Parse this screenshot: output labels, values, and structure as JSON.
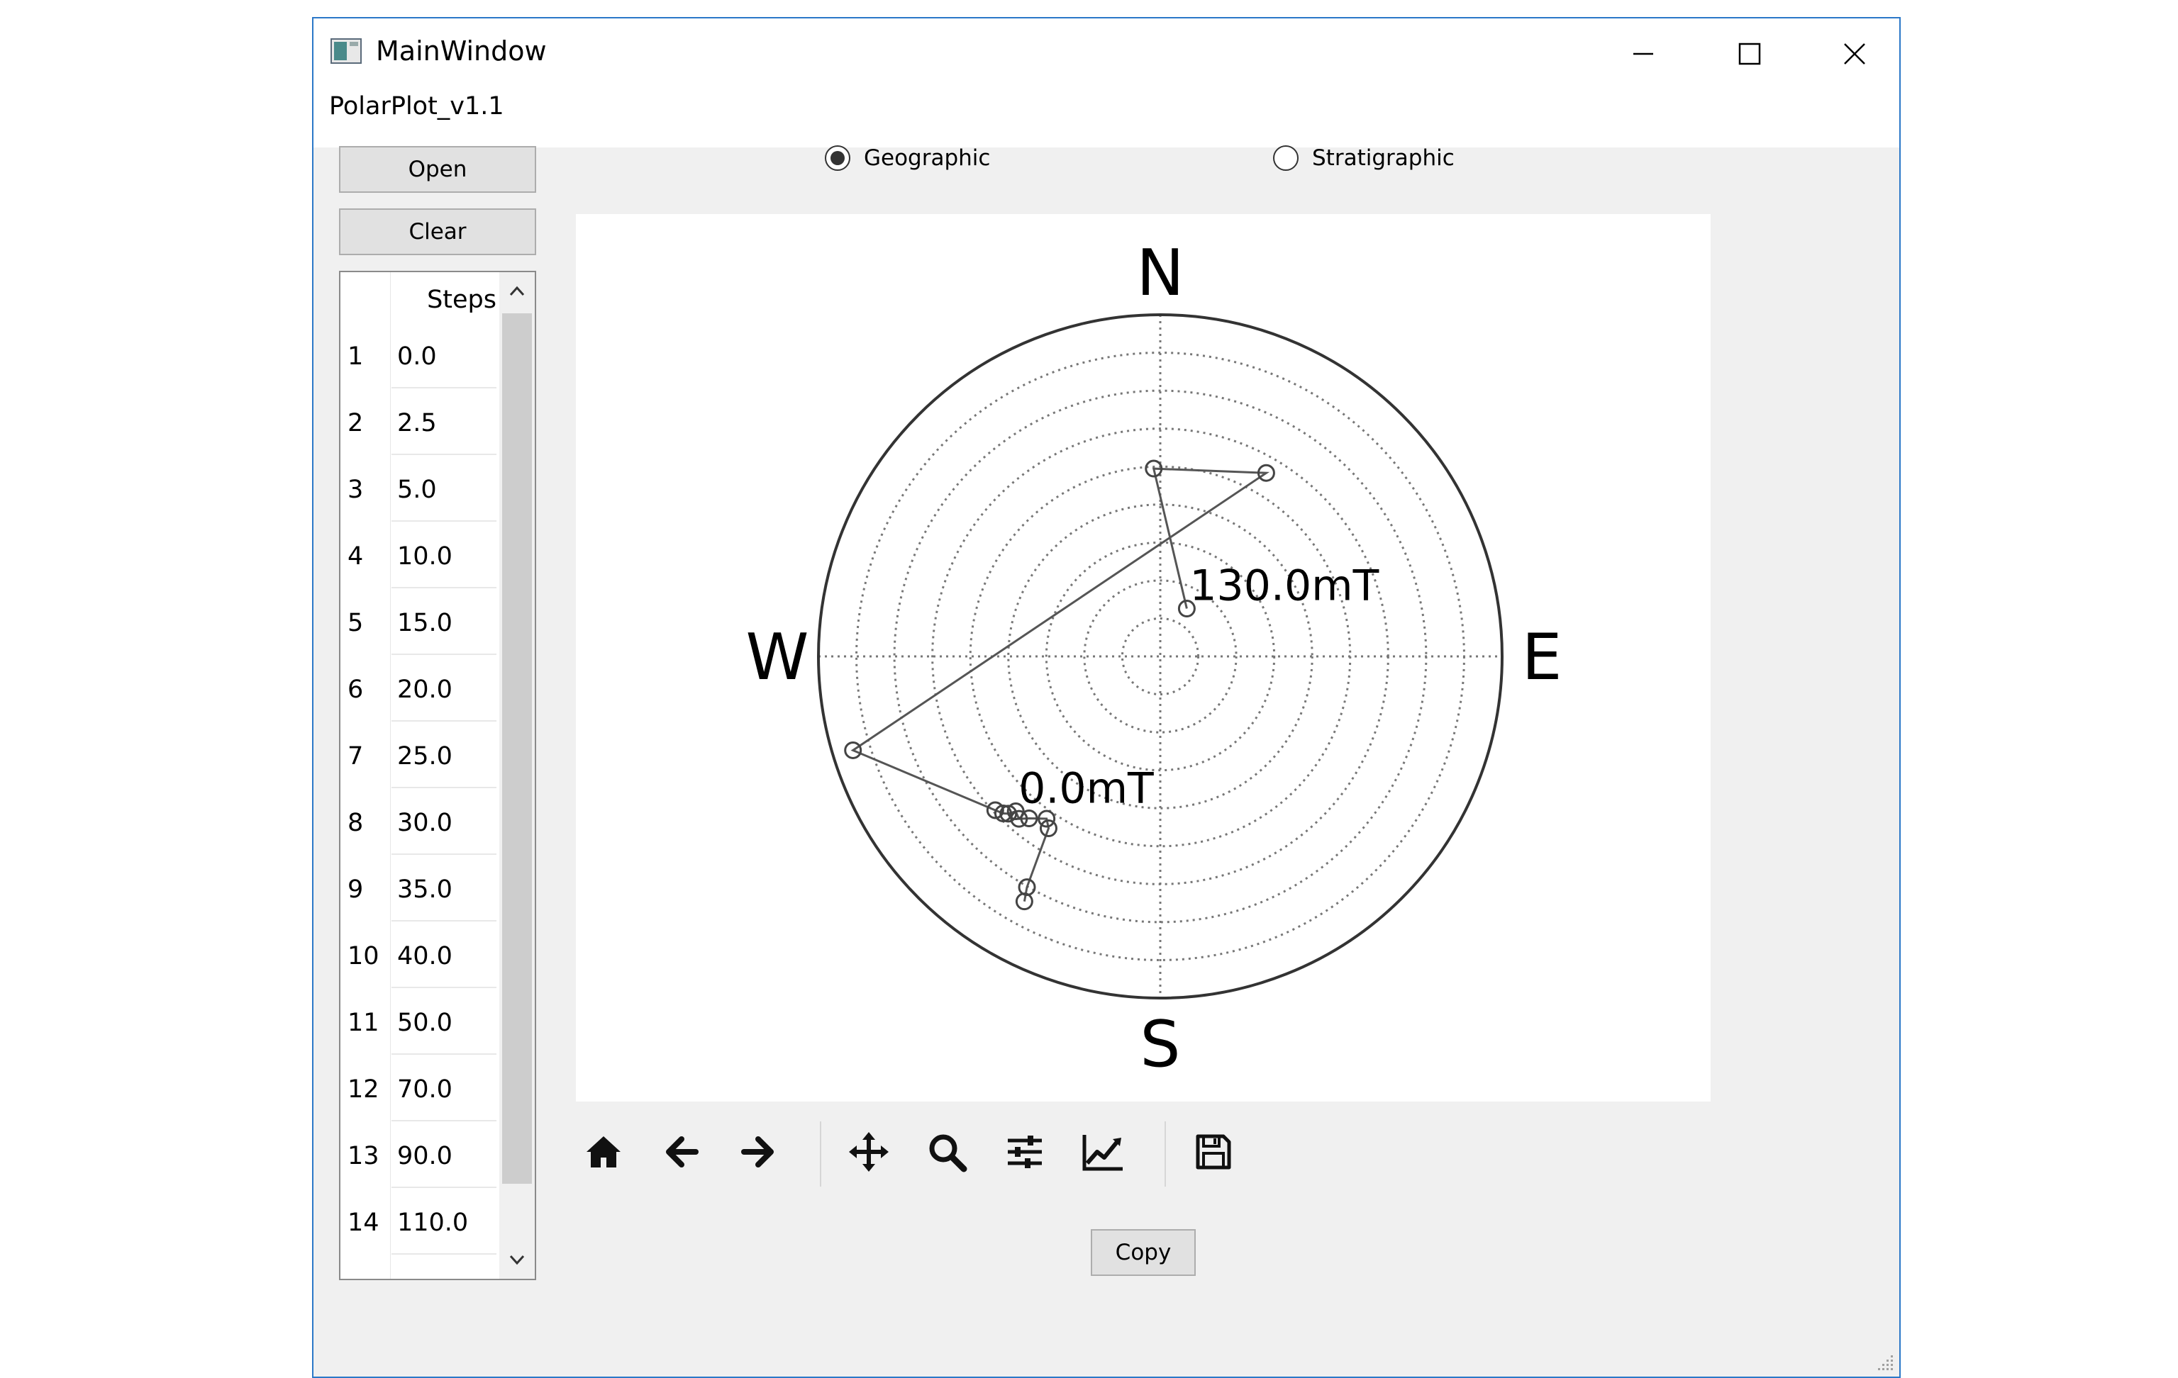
{
  "window": {
    "title": "MainWindow",
    "menu_label": "PolarPlot_v1.1"
  },
  "buttons": {
    "open": "Open",
    "clear": "Clear",
    "copy": "Copy"
  },
  "steps_list": {
    "header": "Steps",
    "rows": [
      {
        "num": "1",
        "value": "0.0"
      },
      {
        "num": "2",
        "value": "2.5"
      },
      {
        "num": "3",
        "value": "5.0"
      },
      {
        "num": "4",
        "value": "10.0"
      },
      {
        "num": "5",
        "value": "15.0"
      },
      {
        "num": "6",
        "value": "20.0"
      },
      {
        "num": "7",
        "value": "25.0"
      },
      {
        "num": "8",
        "value": "30.0"
      },
      {
        "num": "9",
        "value": "35.0"
      },
      {
        "num": "10",
        "value": "40.0"
      },
      {
        "num": "11",
        "value": "50.0"
      },
      {
        "num": "12",
        "value": "70.0"
      },
      {
        "num": "13",
        "value": "90.0"
      },
      {
        "num": "14",
        "value": "110.0"
      }
    ]
  },
  "coordinate_mode": {
    "options": [
      "Geographic",
      "Stratigraphic"
    ],
    "selected": "Geographic"
  },
  "toolbar": {
    "icons": [
      "home-icon",
      "back-icon",
      "forward-icon",
      "pan-icon",
      "zoom-icon",
      "configure-subplots-icon",
      "edit-axis-icon",
      "save-icon"
    ]
  },
  "chart_data": {
    "type": "scatter",
    "projection": "polar",
    "compass_labels": {
      "n": "N",
      "e": "E",
      "s": "S",
      "w": "W"
    },
    "rings": 9,
    "grid": true,
    "points": [
      {
        "azimuth_deg": 209,
        "radius_frac": 0.82
      },
      {
        "azimuth_deg": 210,
        "radius_frac": 0.78
      },
      {
        "azimuth_deg": 213,
        "radius_frac": 0.6
      },
      {
        "azimuth_deg": 215,
        "radius_frac": 0.58
      },
      {
        "azimuth_deg": 219,
        "radius_frac": 0.61
      },
      {
        "azimuth_deg": 221,
        "radius_frac": 0.63
      },
      {
        "azimuth_deg": 223,
        "radius_frac": 0.62
      },
      {
        "azimuth_deg": 224,
        "radius_frac": 0.64
      },
      {
        "azimuth_deg": 225,
        "radius_frac": 0.65
      },
      {
        "azimuth_deg": 227,
        "radius_frac": 0.66
      },
      {
        "azimuth_deg": 253,
        "radius_frac": 0.94
      },
      {
        "azimuth_deg": 30,
        "radius_frac": 0.62
      },
      {
        "azimuth_deg": 358,
        "radius_frac": 0.55
      },
      {
        "azimuth_deg": 29,
        "radius_frac": 0.16
      }
    ],
    "annotations": [
      {
        "text": "0.0mT",
        "point_index": 6
      },
      {
        "text": "130.0mT",
        "point_index": 13
      }
    ]
  }
}
